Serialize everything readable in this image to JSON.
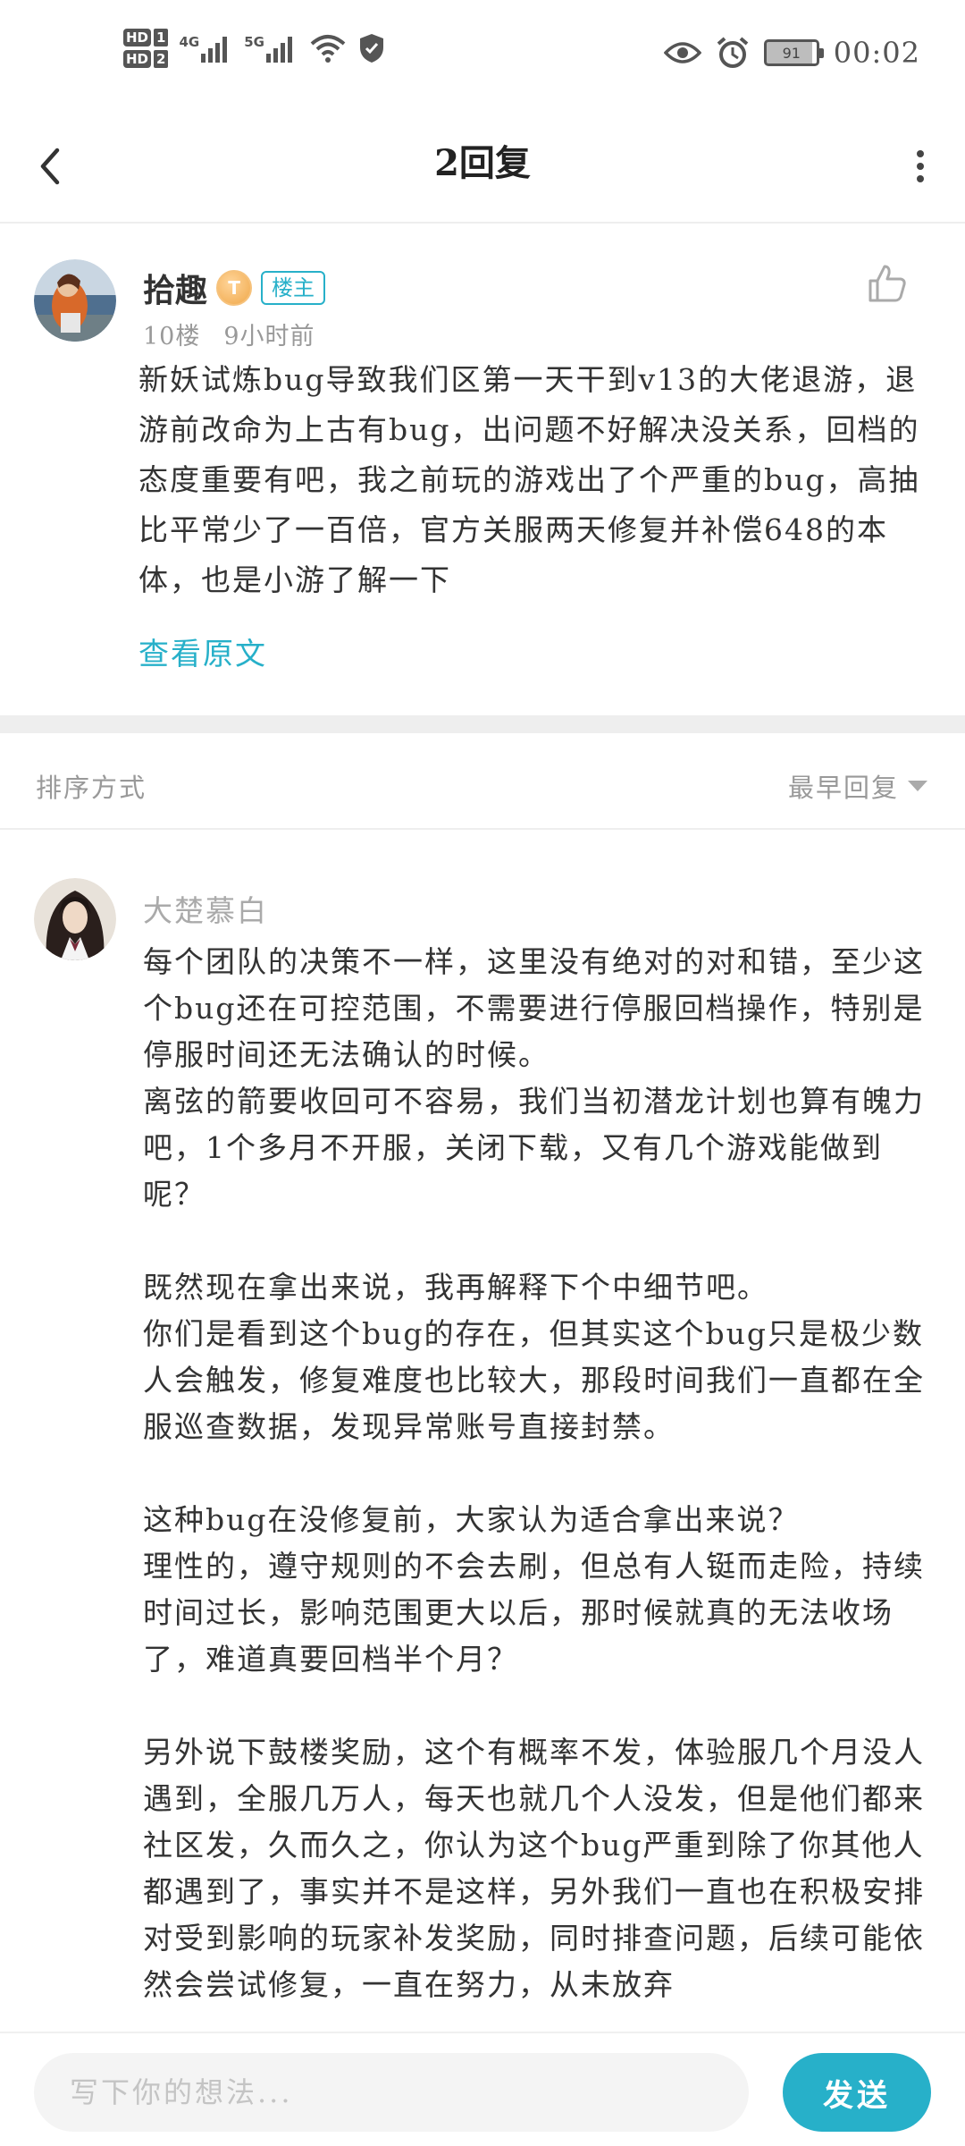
{
  "status_bar": {
    "sim1_label": "HD",
    "sim1_index": "1",
    "sim2_label": "HD",
    "sim2_index": "2",
    "net1": "4G",
    "net2": "5G",
    "battery": "91",
    "time": "00:02"
  },
  "header": {
    "title": "2回复",
    "icons": {
      "back": "chevron-left-icon",
      "more": "more-vertical-icon"
    }
  },
  "post": {
    "author": "拾趣",
    "level_badge": "T",
    "owner_badge": "楼主",
    "floor": "10楼",
    "time": "9小时前",
    "body": "新妖试炼bug导致我们区第一天干到v13的大佬退游，退游前改命为上古有bug，出问题不好解决没关系，回档的态度重要有吧，我之前玩的游戏出了个严重的bug，高抽比平常少了一百倍，官方关服两天修复并补偿648的本体，也是小游了解一下",
    "view_original": "查看原文",
    "icons": {
      "like": "thumbs-up-icon"
    }
  },
  "sort": {
    "label": "排序方式",
    "selected": "最早回复"
  },
  "reply": {
    "author": "大楚慕白",
    "body": "每个团队的决策不一样，这里没有绝对的对和错，至少这个bug还在可控范围，不需要进行停服回档操作，特别是停服时间还无法确认的时候。\n离弦的箭要收回可不容易，我们当初潜龙计划也算有魄力吧，1个多月不开服，关闭下载，又有几个游戏能做到呢？\n\n既然现在拿出来说，我再解释下个中细节吧。\n你们是看到这个bug的存在，但其实这个bug只是极少数人会触发，修复难度也比较大，那段时间我们一直都在全服巡查数据，发现异常账号直接封禁。\n\n这种bug在没修复前，大家认为适合拿出来说？\n理性的，遵守规则的不会去刷，但总有人铤而走险，持续时间过长，影响范围更大以后，那时候就真的无法收场了，难道真要回档半个月？\n\n另外说下鼓楼奖励，这个有概率不发，体验服几个月没人遇到，全服几万人，每天也就几个人没发，但是他们都来社区发，久而久之，你认为这个bug严重到除了你其他人都遇到了，事实并不是这样，另外我们一直也在积极安排对受到影响的玩家补发奖励，同时排查问题，后续可能依然会尝试修复，一直在努力，从未放弃"
  },
  "composer": {
    "placeholder": "写下你的想法...",
    "send_label": "发送"
  },
  "colors": {
    "accent": "#27b0c9",
    "text": "#333333",
    "muted": "#999999"
  }
}
